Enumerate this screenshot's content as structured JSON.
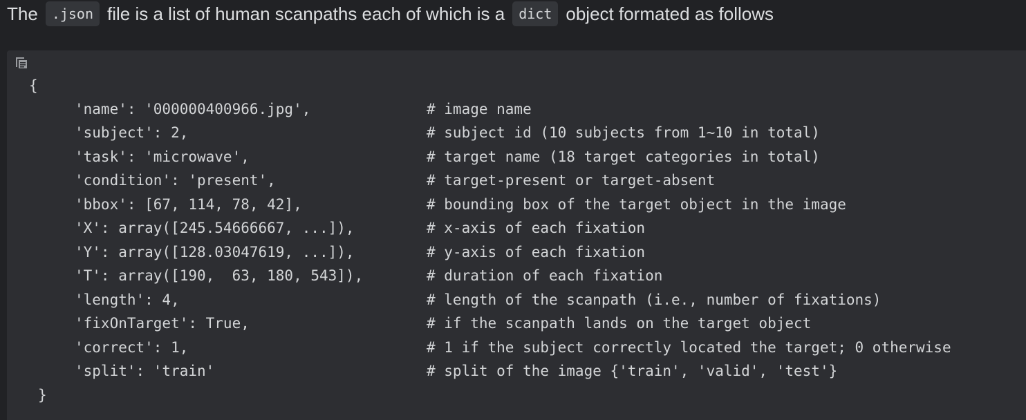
{
  "intro": {
    "t1": "The",
    "code1": ".json",
    "t2": "file is a list of human scanpaths each of which is a",
    "code2": "dict",
    "t3": "object formated as follows"
  },
  "code": {
    "copy_icon": "copy-icon",
    "open_brace": "{",
    "close_brace": "}",
    "lines": [
      {
        "code": "'name': '000000400966.jpg',",
        "comment": "# image name"
      },
      {
        "code": "'subject': 2,",
        "comment": "# subject id (10 subjects from 1~10 in total)"
      },
      {
        "code": "'task': 'microwave',",
        "comment": "# target name (18 target categories in total)"
      },
      {
        "code": "'condition': 'present',",
        "comment": "# target-present or target-absent"
      },
      {
        "code": "'bbox': [67, 114, 78, 42],",
        "comment": "# bounding box of the target object in the image"
      },
      {
        "code": "'X': array([245.54666667, ...]),",
        "comment": "# x-axis of each fixation"
      },
      {
        "code": "'Y': array([128.03047619, ...]),",
        "comment": "# y-axis of each fixation"
      },
      {
        "code": "'T': array([190,  63, 180, 543]),",
        "comment": "# duration of each fixation"
      },
      {
        "code": "'length': 4,",
        "comment": "# length of the scanpath (i.e., number of fixations)"
      },
      {
        "code": "'fixOnTarget': True,",
        "comment": "# if the scanpath lands on the target object"
      },
      {
        "code": "'correct': 1,",
        "comment": "# 1 if the subject correctly located the target; 0 otherwise"
      },
      {
        "code": "'split': 'train'",
        "comment": "# split of the image {'train', 'valid', 'test'}"
      }
    ]
  }
}
